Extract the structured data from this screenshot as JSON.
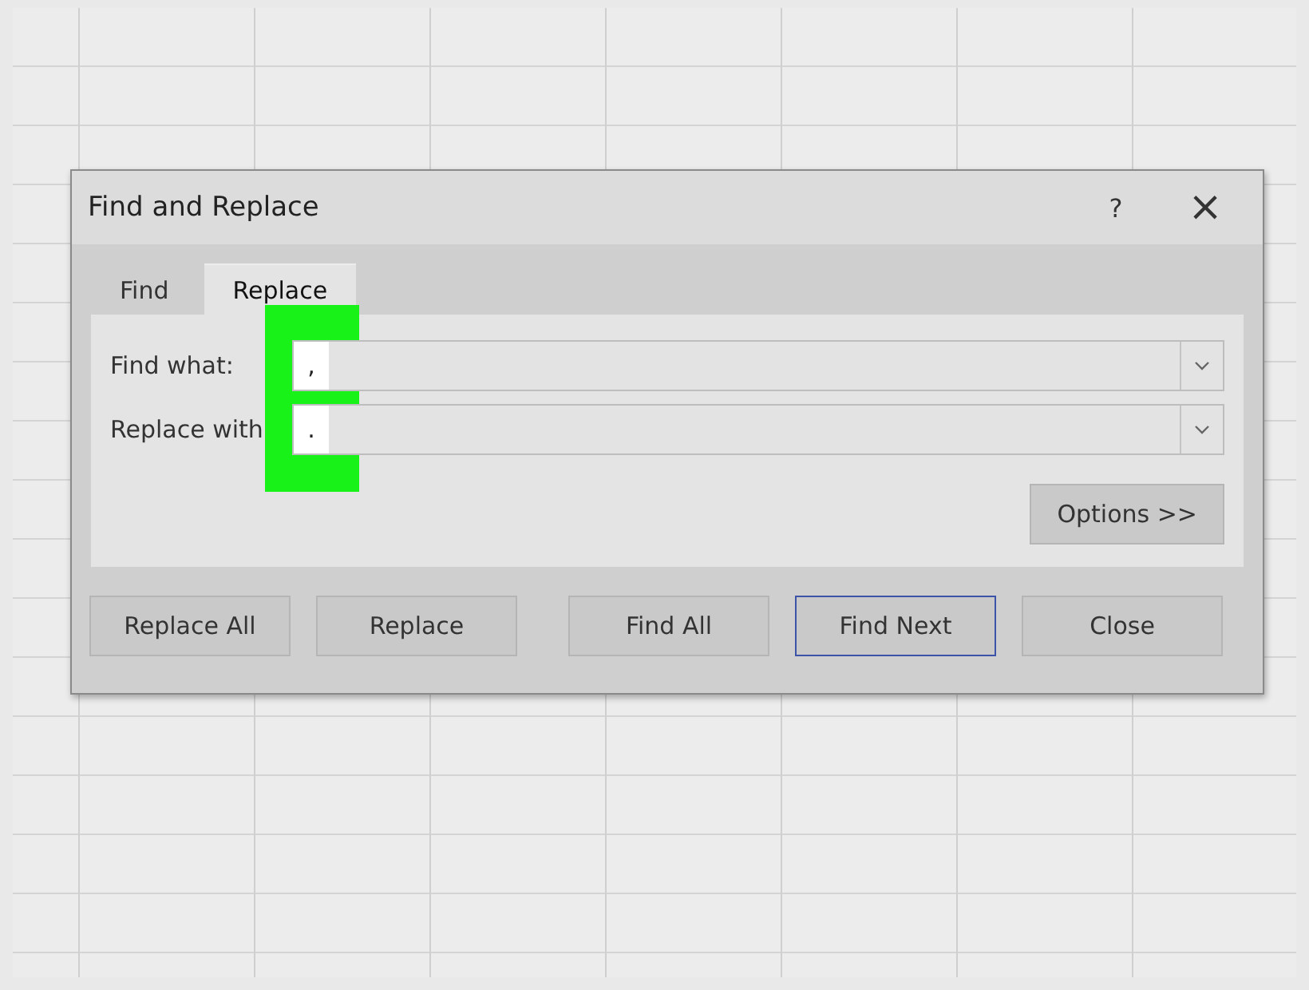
{
  "window": {
    "title": "Find and Replace",
    "help": "?",
    "close": "×"
  },
  "tabs": [
    {
      "label": "Find",
      "selected": false
    },
    {
      "label": "Replace",
      "selected": true
    }
  ],
  "fields": [
    {
      "label": "Find what:",
      "value": ","
    },
    {
      "label": "Replace with",
      "value": "."
    }
  ],
  "options_button": "Options >>",
  "buttons": [
    {
      "label": "Replace All",
      "focused": false
    },
    {
      "label": "Replace",
      "focused": false
    },
    {
      "label": "Find All",
      "focused": false
    },
    {
      "label": "Find Next",
      "focused": true
    },
    {
      "label": "Close",
      "focused": false
    }
  ]
}
